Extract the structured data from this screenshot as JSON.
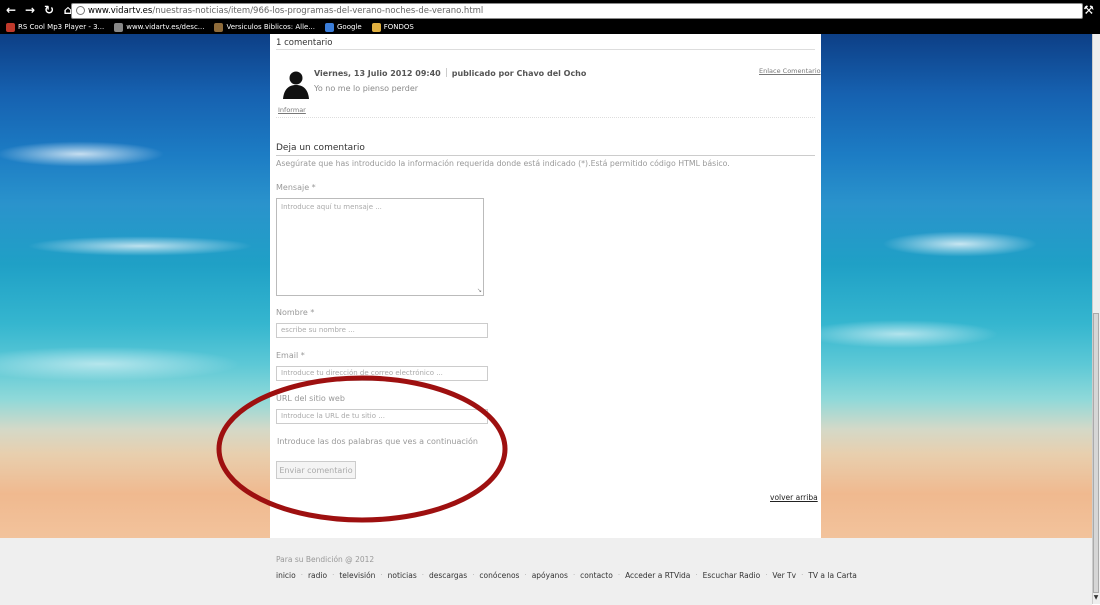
{
  "browser": {
    "url_host": "www.vidartv.es",
    "url_path": "/nuestras-noticias/item/966-los-programas-del-verano-noches-de-verano.html",
    "bookmarks": [
      {
        "label": "RS Cool Mp3 Player - 3...",
        "color": "#c0392b"
      },
      {
        "label": "www.vidartv.es/desc...",
        "color": "#888888"
      },
      {
        "label": "Versiculos Biblicos: Alle...",
        "color": "#8e6b3a"
      },
      {
        "label": "Google",
        "color": "#3b7dd8"
      },
      {
        "label": "FONDOS",
        "color": "#e0b040"
      }
    ]
  },
  "comments": {
    "heading": "1 comentario",
    "item": {
      "date": "Viernes, 13 Julio 2012 09:40",
      "author_prefix": "publicado por",
      "author": "Chavo del Ocho",
      "text": "Yo no me lo pienso perder",
      "link_label": "Enlace Comentario",
      "report_label": "Informar"
    }
  },
  "form": {
    "title": "Deja un comentario",
    "notice": "Asegúrate que has introducido la información requerida donde está indicado (*).Está permitido código HTML básico.",
    "message_label": "Mensaje *",
    "message_placeholder": "Introduce aquí tu mensaje ...",
    "name_label": "Nombre *",
    "name_placeholder": "escribe su nombre ...",
    "email_label": "Email *",
    "email_placeholder": "Introduce tu dirección de correo electrónico ...",
    "url_label": "URL del sitio web",
    "url_placeholder": "Introduce la URL de tu sitio ...",
    "captcha_note": "Introduce las dos palabras que ves a continuación",
    "submit_label": "Enviar comentario"
  },
  "back_to_top": "volver arriba",
  "footer": {
    "copyright": "Para su Bendición @ 2012",
    "nav": [
      "inicio",
      "radio",
      "televisión",
      "noticias",
      "descargas",
      "conócenos",
      "apóyanos",
      "contacto",
      "Acceder a RTVida",
      "Escuchar Radio",
      "Ver Tv",
      "TV a la Carta"
    ]
  },
  "colors": {
    "annotation": "#9e1010"
  }
}
